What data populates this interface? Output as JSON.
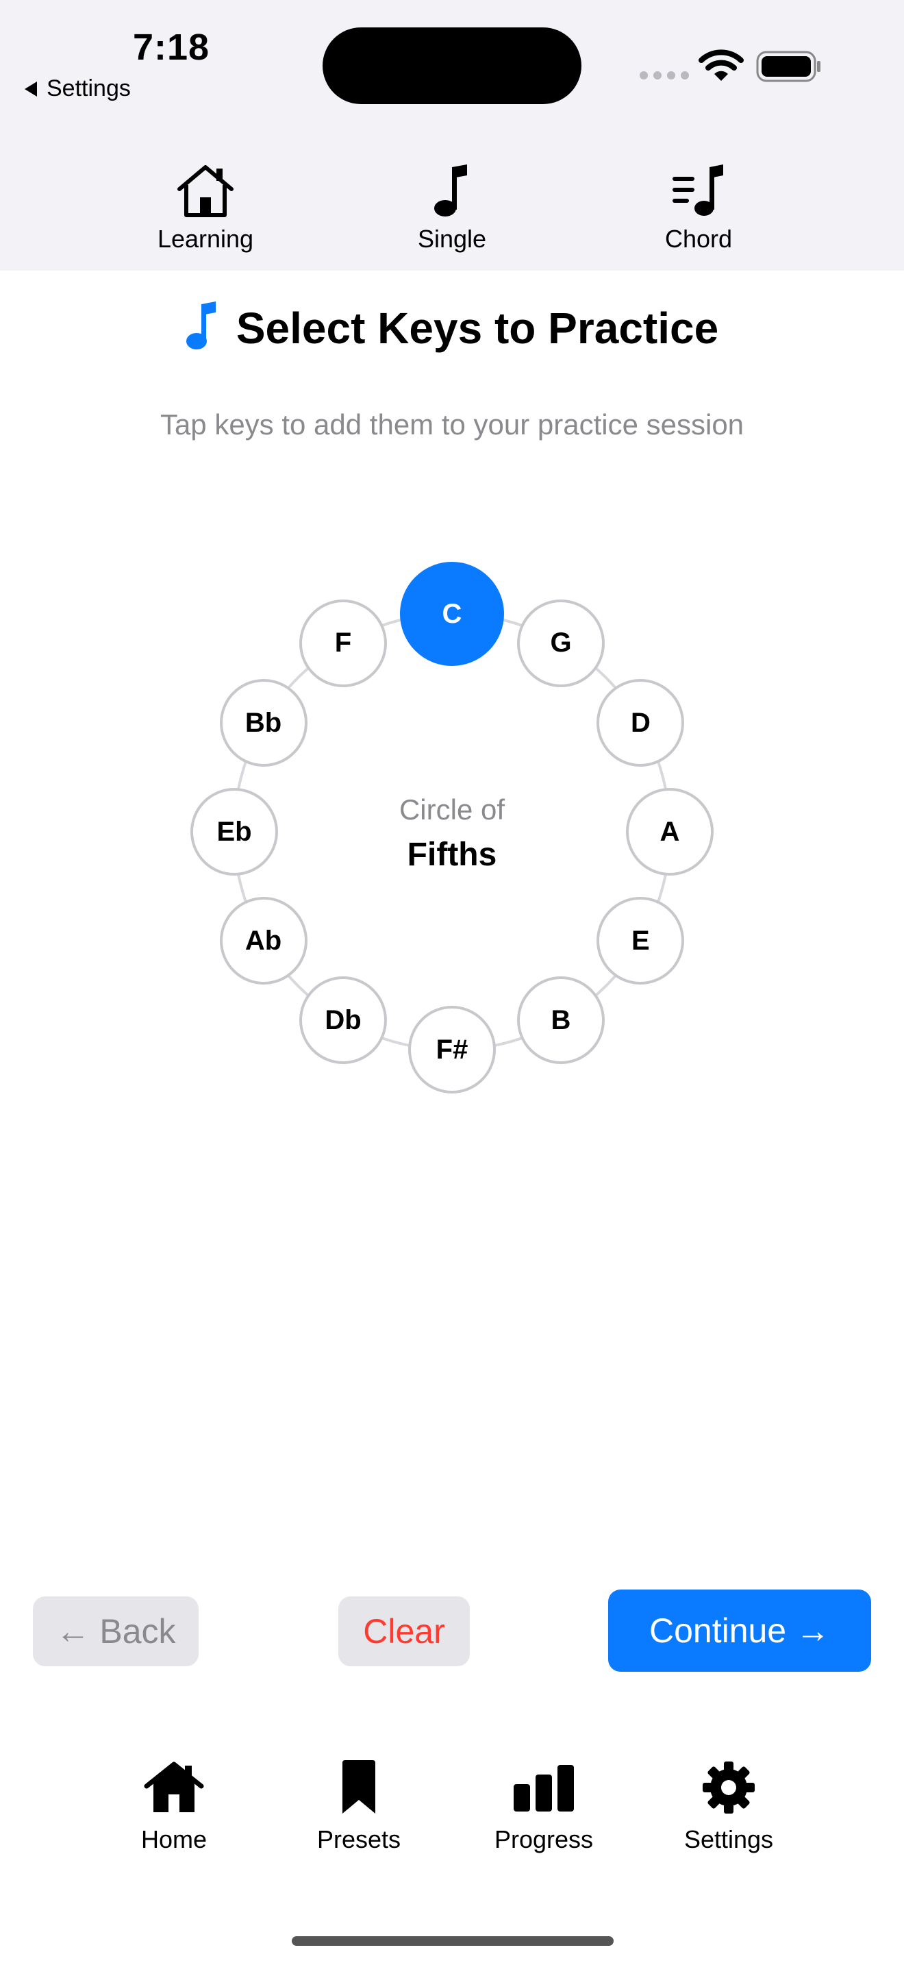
{
  "status_bar": {
    "time": "7:18",
    "back_label": "Settings",
    "icons": [
      "signal-icon",
      "wifi-icon",
      "battery-icon"
    ]
  },
  "top_tabs": [
    {
      "label": "Learning",
      "icon": "house-icon"
    },
    {
      "label": "Single",
      "icon": "music-note-icon"
    },
    {
      "label": "Chord",
      "icon": "chord-list-icon"
    }
  ],
  "header": {
    "title": "Select Keys to Practice",
    "title_icon": "music-note-icon",
    "subtitle": "Tap keys to add them to your practice session"
  },
  "circle": {
    "center_top": "Circle of",
    "center_main": "Fifths",
    "keys": [
      "C",
      "G",
      "D",
      "A",
      "E",
      "B",
      "F#",
      "Db",
      "Ab",
      "Eb",
      "Bb",
      "F"
    ],
    "selected": [
      "C"
    ]
  },
  "actions": {
    "back_label": "← Back",
    "clear_label": "Clear",
    "continue_label": "Continue →"
  },
  "bottom_tabs": [
    {
      "label": "Home",
      "icon": "house-fill-icon"
    },
    {
      "label": "Presets",
      "icon": "bookmark-icon"
    },
    {
      "label": "Progress",
      "icon": "chart-bar-icon"
    },
    {
      "label": "Settings",
      "icon": "gear-icon"
    }
  ],
  "colors": {
    "accent": "#0a7aff",
    "destructive": "#ff3b30",
    "secondary_text": "#8a8a8e",
    "top_background": "#f2f2f7"
  }
}
